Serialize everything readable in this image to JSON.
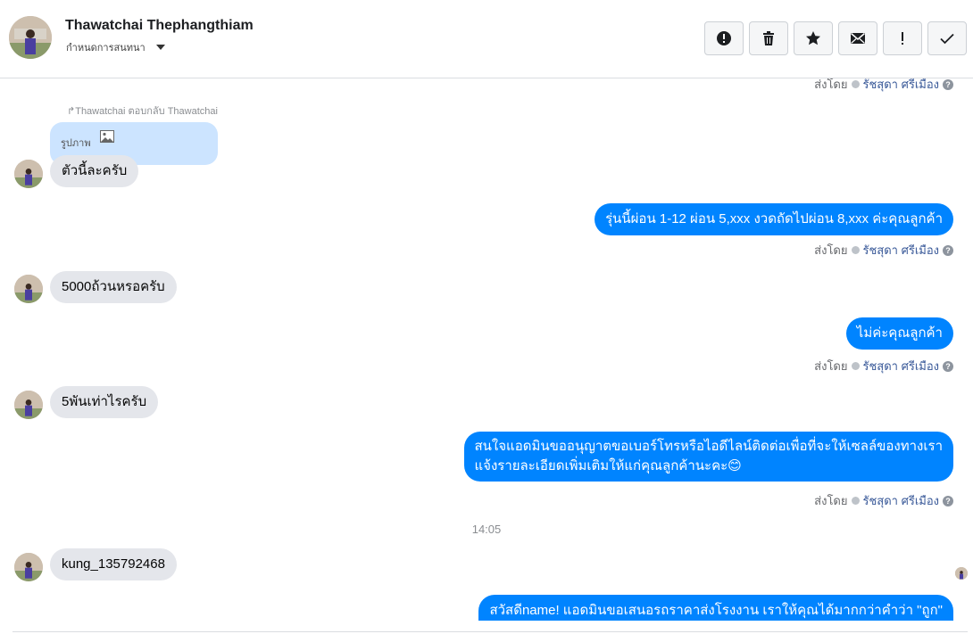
{
  "header": {
    "name": "Thawatchai Thephangthiam",
    "subtitle": "กำหนดการสนทนา",
    "tools": [
      {
        "name": "report-button",
        "icon": "alert-circle-icon"
      },
      {
        "name": "delete-button",
        "icon": "trash-icon"
      },
      {
        "name": "star-button",
        "icon": "star-icon"
      },
      {
        "name": "mark-unread-button",
        "icon": "mail-icon"
      },
      {
        "name": "important-button",
        "icon": "exclamation-icon"
      },
      {
        "name": "done-button",
        "icon": "check-icon"
      }
    ]
  },
  "sent_prefix": "ส่งโดย",
  "sent_by": "รัชสุดา ศรีเมือง",
  "reply": {
    "note": "Thawatchai ตอบกลับ Thawatchai",
    "quoted_label": "รูปภาพ"
  },
  "messages": {
    "in1": "ตัวนี้ละครับ",
    "out1": "รุ่นนี้ผ่อน 1-12 ผ่อน 5,xxx งวดถัดไปผ่อน 8,xxx ค่ะคุณลูกค้า",
    "in2": "5000ถ้วนหรอครับ",
    "out2": "ไม่ค่ะคุณลูกค้า",
    "in3": "5พันเท่าไรครับ",
    "out3_line1": "สนใจแอดมินขออนุญาตขอเบอร์โทรหรือไอดีไลน์ติดต่อเพื่อที่จะให้เซลล์ของทางเรา",
    "out3_line2": "แจ้งรายละเอียดเพิ่มเติมให้แก่คุณลูกค้านะคะ😊",
    "time": "14:05",
    "in4": "kung_135792468",
    "out4": "สวัสดีname! แอดมินขอเสนอรถราคาส่งโรงงาน เราให้คุณได้มากกว่าคำว่า \"ถูก\""
  },
  "colors": {
    "outgoing": "#0084ff",
    "incoming": "#e4e6eb",
    "reply_box": "#cce4ff"
  }
}
